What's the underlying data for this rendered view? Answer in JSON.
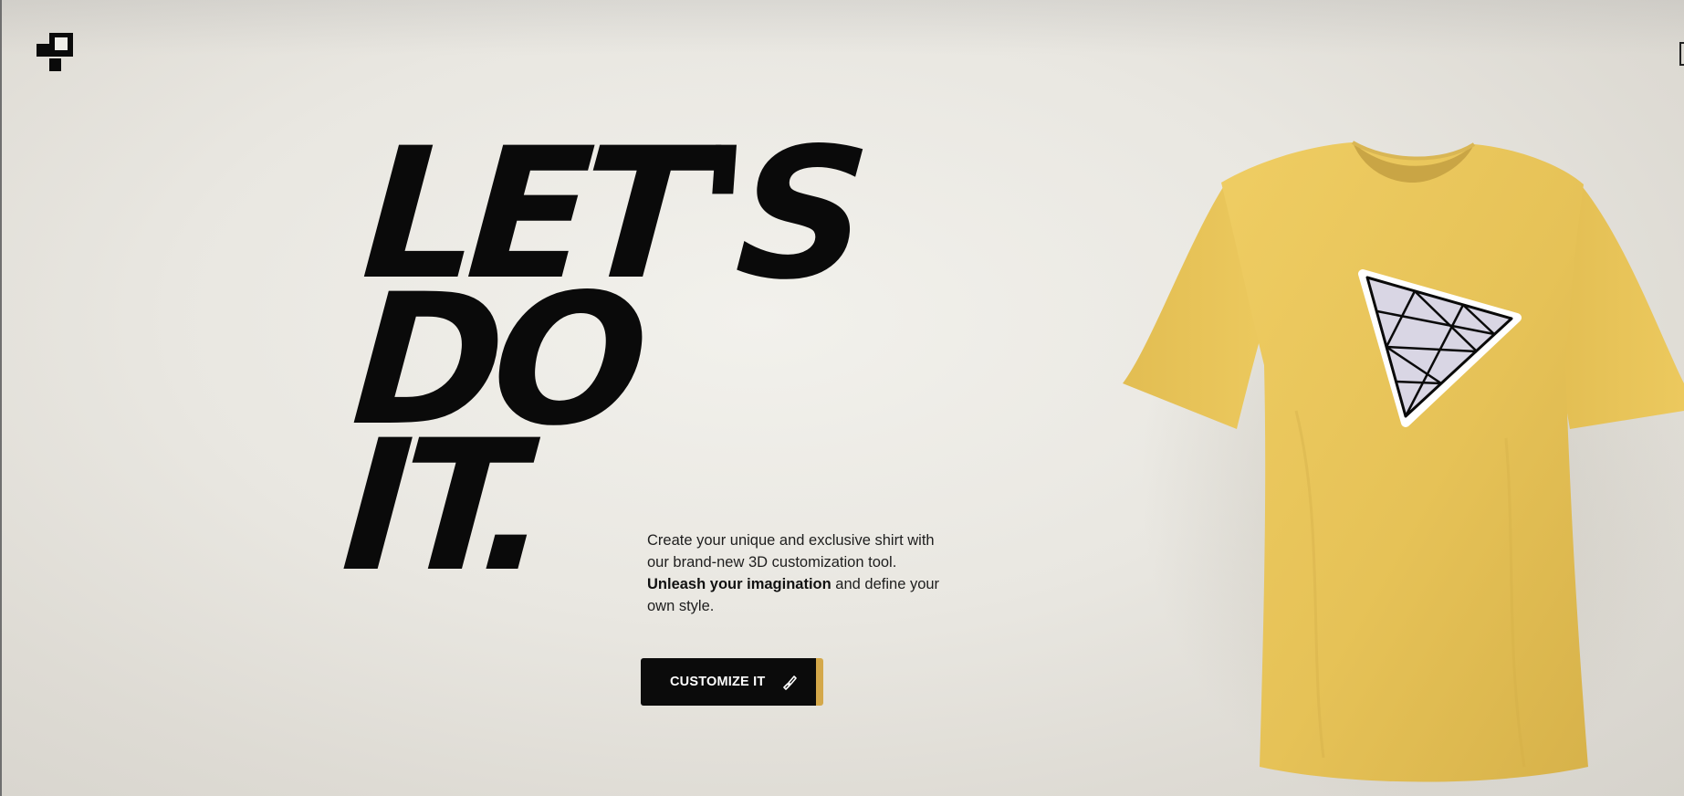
{
  "brand": {
    "logo_icon": "pixel-blocks-logo-icon"
  },
  "hero": {
    "headline_line1": "LET'S",
    "headline_line2": "DO",
    "headline_line3": "IT.",
    "description_part1": "Create your unique and exclusive shirt with our brand-new 3D customization tool.",
    "description_bold": "Unleash your imagination",
    "description_part2": "and define your own style.",
    "cta_label": "CUSTOMIZE IT",
    "cta_icon": "paint-brush-icon"
  },
  "product": {
    "shirt_color": "#e8c458",
    "decal_icon": "triangle-grid-decal-icon"
  },
  "colors": {
    "background": "#ebe9e3",
    "text": "#0a0a0a",
    "cta_background": "#0b0b0b",
    "cta_accent": "#d4a84a"
  }
}
